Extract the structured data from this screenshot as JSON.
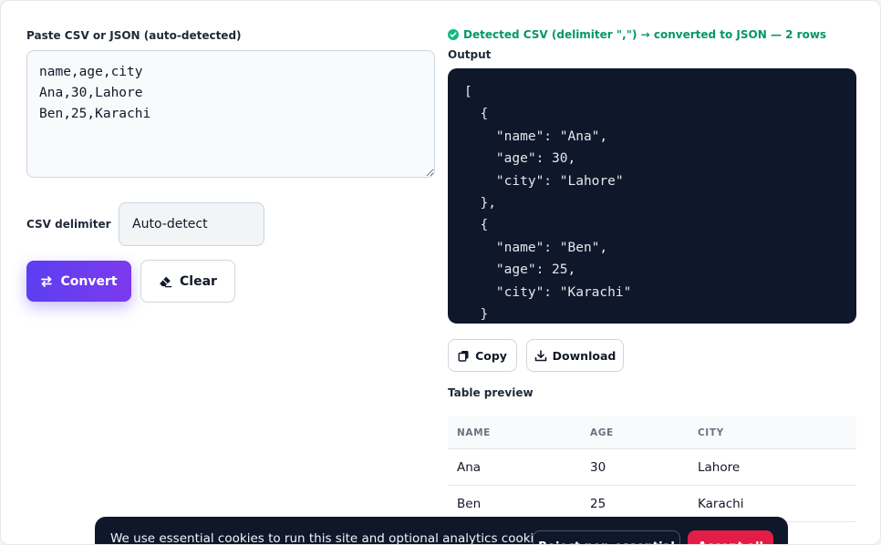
{
  "input": {
    "label": "Paste CSV or JSON (auto-detected)",
    "value": "name,age,city\nAna,30,Lahore\nBen,25,Karachi"
  },
  "delimiter": {
    "label": "CSV delimiter",
    "value": "Auto-detect"
  },
  "buttons": {
    "convert": "Convert",
    "clear": "Clear",
    "copy": "Copy",
    "download": "Download"
  },
  "status": {
    "text": "Detected CSV (delimiter \",\") → converted to JSON — 2 rows",
    "color": "#059669"
  },
  "output": {
    "label": "Output",
    "json": "[\n  {\n    \"name\": \"Ana\",\n    \"age\": 30,\n    \"city\": \"Lahore\"\n  },\n  {\n    \"name\": \"Ben\",\n    \"age\": 25,\n    \"city\": \"Karachi\"\n  }\n]"
  },
  "preview": {
    "label": "Table preview",
    "columns": [
      "NAME",
      "AGE",
      "CITY"
    ],
    "rows": [
      [
        "Ana",
        "30",
        "Lahore"
      ],
      [
        "Ben",
        "25",
        "Karachi"
      ]
    ]
  },
  "cookie": {
    "text": "We use essential cookies to run this site and optional analytics cookies",
    "reject": "Reject non-essential",
    "accept": "Accept all"
  },
  "colors": {
    "accent": "#5b3ff0",
    "code_bg": "#0f172a",
    "accept": "#e11d48"
  }
}
